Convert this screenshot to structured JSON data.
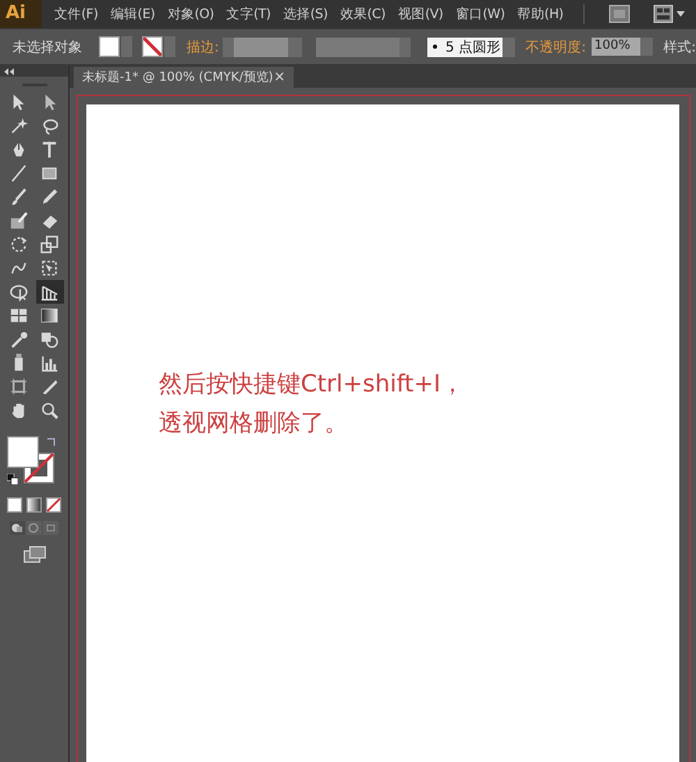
{
  "app": {
    "logo": "Ai"
  },
  "menu": [
    {
      "label": "文件(F)"
    },
    {
      "label": "编辑(E)"
    },
    {
      "label": "对象(O)"
    },
    {
      "label": "文字(T)"
    },
    {
      "label": "选择(S)"
    },
    {
      "label": "效果(C)"
    },
    {
      "label": "视图(V)"
    },
    {
      "label": "窗口(W)"
    },
    {
      "label": "帮助(H)"
    }
  ],
  "control_bar": {
    "selection_label": "未选择对象",
    "stroke_label": "描边:",
    "brush_value": "5 点圆形",
    "opacity_label": "不透明度:",
    "opacity_value": "100%",
    "style_label": "样式:"
  },
  "document_tab": {
    "title": "未标题-1* @ 100% (CMYK/预览)",
    "close": "×"
  },
  "tools": [
    {
      "selected": false
    },
    {
      "selected": false
    },
    {
      "selected": false
    },
    {
      "selected": false
    },
    {
      "selected": false
    },
    {
      "selected": false
    },
    {
      "selected": false
    },
    {
      "selected": false
    },
    {
      "selected": false
    },
    {
      "selected": false
    },
    {
      "selected": false
    },
    {
      "selected": false
    },
    {
      "selected": false
    },
    {
      "selected": false
    },
    {
      "selected": false
    },
    {
      "selected": false
    },
    {
      "selected": false
    },
    {
      "selected": true
    },
    {
      "selected": false
    },
    {
      "selected": false
    },
    {
      "selected": false
    },
    {
      "selected": false
    },
    {
      "selected": false
    },
    {
      "selected": false
    },
    {
      "selected": false
    },
    {
      "selected": false
    },
    {
      "selected": false
    },
    {
      "selected": false
    }
  ],
  "canvas_text": [
    "然后按快捷键Ctrl+shift+I，",
    "透视网格删除了。"
  ]
}
